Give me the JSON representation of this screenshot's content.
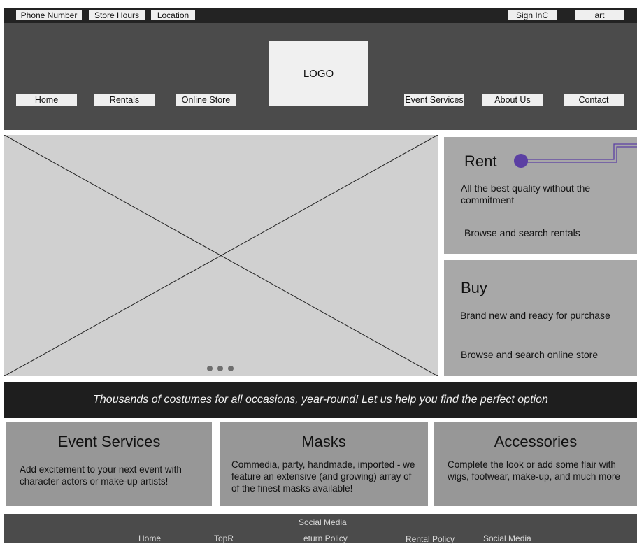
{
  "topbar": {
    "phone": "Phone Number",
    "hours": "Store Hours",
    "location": "Location",
    "signin": "Sign InC",
    "cart": "art"
  },
  "header": {
    "logo": "LOGO",
    "nav": {
      "home": "Home",
      "rentals": "Rentals",
      "online_store": "Online Store",
      "event_services": "Event Services",
      "about": "About Us",
      "contact": "Contact"
    }
  },
  "hero": {
    "carousel_dots": 3,
    "placeholder_icon": "image-placeholder-icon"
  },
  "rent": {
    "title": "Rent",
    "description": "All the best quality without the commitment",
    "link": "Browse and search rentals",
    "accent_color": "#5b3fa3"
  },
  "buy": {
    "title": "Buy",
    "description": "Brand new and ready for purchase",
    "link": "Browse and search online store"
  },
  "banner": {
    "text": "Thousands of costumes for all occasions, year-round! Let us help you find the perfect option"
  },
  "cards": {
    "event": {
      "title": "Event Services",
      "text": "Add excitement to your next event with character actors or make-up artists!"
    },
    "masks": {
      "title": "Masks",
      "text": "Commedia, party, handmade, imported - we feature an extensive (and growing) array of of the finest masks available!"
    },
    "accessories": {
      "title": "Accessories",
      "text": "Complete the look or add some flair with wigs, footwear, make-up, and much more"
    }
  },
  "footer": {
    "social_heading": "Social Media",
    "home": "Home",
    "top": "TopR",
    "return_policy": "eturn Policy",
    "rental_policy": "Rental Policy",
    "social": "Social Media"
  }
}
